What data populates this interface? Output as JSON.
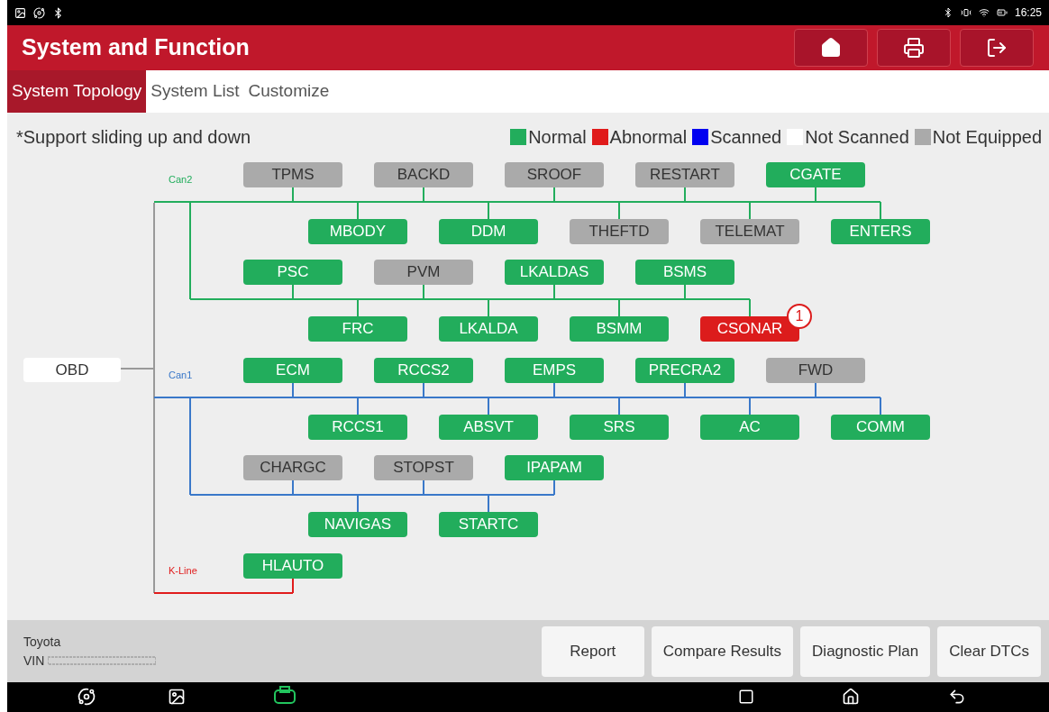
{
  "status_bar": {
    "time": "16:25"
  },
  "header": {
    "title": "System and Function"
  },
  "tabs": [
    {
      "label": "System Topology",
      "selected": true
    },
    {
      "label": "System List",
      "selected": false
    },
    {
      "label": "Customize",
      "selected": false
    }
  ],
  "hint": "*Support sliding up and down",
  "legend": [
    {
      "label": "Normal",
      "color": "#22ad5c"
    },
    {
      "label": "Abnormal",
      "color": "#e01b1b"
    },
    {
      "label": "Scanned",
      "color": "#0000f0"
    },
    {
      "label": "Not Scanned",
      "color": "#ffffff"
    },
    {
      "label": "Not Equipped",
      "color": "#aaaaaa"
    }
  ],
  "root": {
    "label": "OBD"
  },
  "buses": [
    {
      "label": "Can2",
      "color": "#22ad5c",
      "groups": [
        {
          "top": [
            {
              "label": "TPMS",
              "kind": "absent"
            },
            {
              "label": "BACKD",
              "kind": "absent"
            },
            {
              "label": "SROOF",
              "kind": "absent"
            },
            {
              "label": "RESTART",
              "kind": "absent"
            },
            {
              "label": "CGATE",
              "kind": "normal"
            }
          ],
          "bottom": [
            {
              "label": "MBODY",
              "kind": "normal"
            },
            {
              "label": "DDM",
              "kind": "normal"
            },
            {
              "label": "THEFTD",
              "kind": "absent"
            },
            {
              "label": "TELEMAT",
              "kind": "absent"
            },
            {
              "label": "ENTERS",
              "kind": "normal"
            }
          ]
        },
        {
          "top": [
            {
              "label": "PSC",
              "kind": "normal"
            },
            {
              "label": "PVM",
              "kind": "absent"
            },
            {
              "label": "LKALDAS",
              "kind": "normal"
            },
            {
              "label": "BSMS",
              "kind": "normal"
            }
          ],
          "bottom": [
            {
              "label": "FRC",
              "kind": "normal"
            },
            {
              "label": "LKALDA",
              "kind": "normal"
            },
            {
              "label": "BSMM",
              "kind": "normal"
            },
            {
              "label": "CSONAR",
              "kind": "abnormal",
              "badge": "1"
            }
          ]
        }
      ]
    },
    {
      "label": "Can1",
      "color": "#3a78c9",
      "groups": [
        {
          "top": [
            {
              "label": "ECM",
              "kind": "normal"
            },
            {
              "label": "RCCS2",
              "kind": "normal"
            },
            {
              "label": "EMPS",
              "kind": "normal"
            },
            {
              "label": "PRECRA2",
              "kind": "normal"
            },
            {
              "label": "FWD",
              "kind": "absent"
            }
          ],
          "bottom": [
            {
              "label": "RCCS1",
              "kind": "normal"
            },
            {
              "label": "ABSVT",
              "kind": "normal"
            },
            {
              "label": "SRS",
              "kind": "normal"
            },
            {
              "label": "AC",
              "kind": "normal"
            },
            {
              "label": "COMM",
              "kind": "normal"
            }
          ]
        },
        {
          "top": [
            {
              "label": "CHARGC",
              "kind": "absent"
            },
            {
              "label": "STOPST",
              "kind": "absent"
            },
            {
              "label": "IPAPAM",
              "kind": "normal"
            }
          ],
          "bottom": [
            {
              "label": "NAVIGAS",
              "kind": "normal"
            },
            {
              "label": "STARTC",
              "kind": "normal"
            }
          ]
        }
      ]
    },
    {
      "label": "K-Line",
      "color": "#e01b1b",
      "groups": [
        {
          "top": [
            {
              "label": "HLAUTO",
              "kind": "normal"
            }
          ]
        }
      ]
    }
  ],
  "footer": {
    "make": "Toyota",
    "vin_label": "VIN"
  },
  "buttons": [
    "Report",
    "Compare Results",
    "Diagnostic Plan",
    "Clear DTCs"
  ]
}
